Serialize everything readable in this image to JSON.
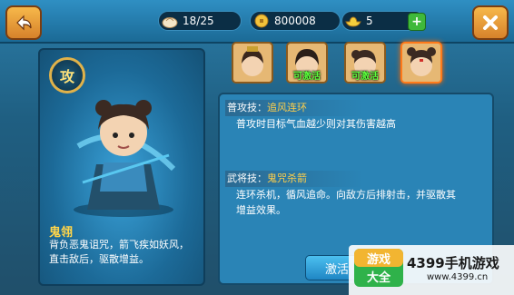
{
  "resources": {
    "food": "18/25",
    "coins": "800008",
    "ingots": "5"
  },
  "hero": {
    "badge": "攻",
    "name": "鬼翎",
    "description": "背负恶鬼诅咒，箭飞疾如妖风，直击敌后，驱散增益。"
  },
  "portraits": [
    {
      "label": ""
    },
    {
      "label": "可激活"
    },
    {
      "label": "可激活"
    },
    {
      "label": ""
    }
  ],
  "skills": [
    {
      "prefix": "普攻技：",
      "name": "追风连环",
      "text": "普攻时目标气血越少则对其伤害越高"
    },
    {
      "prefix": "武将技：",
      "name": "鬼咒杀箭",
      "text": "连环杀机，循风追命。向敌方后排射击，并驱散其增益效果。"
    }
  ],
  "activate_label": "激活",
  "watermark": {
    "logo_text": "游戏大全",
    "brand": "4399手机游戏",
    "url": "www.4399.cn"
  },
  "colors": {
    "accent_gold": "#ffd54a",
    "activate_green": "#5bff3c",
    "panel_blue": "#2a84b6"
  },
  "icons": [
    "back-arrow-icon",
    "close-x-icon",
    "food-bun-icon",
    "gold-coin-icon",
    "ingot-icon",
    "plus-icon"
  ]
}
